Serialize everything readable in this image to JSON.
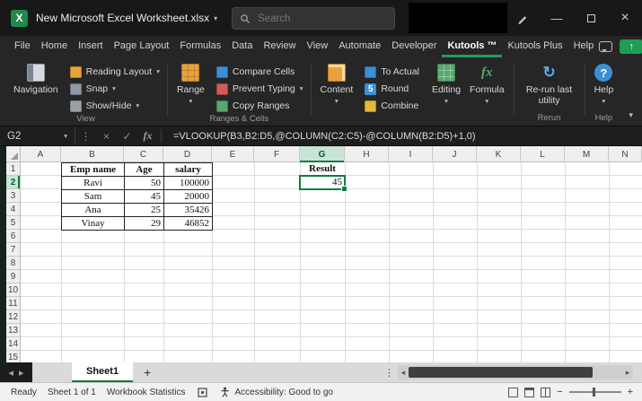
{
  "colors": {
    "accent_green": "#107C41",
    "excel_brand_green": "#1E8A4C"
  },
  "icons": {
    "caret": "▾",
    "dots": "⋮",
    "cancel": "×",
    "confirm": "✓",
    "fx": "fx",
    "minimize": "—",
    "close": "×",
    "plus": "+",
    "app_x": "X",
    "sheet_prev": "◂",
    "sheet_next": "▸",
    "scroll_left": "◂",
    "scroll_right": "▸",
    "overflow": "⋮",
    "zoom_minus": "−",
    "zoom_plus": "+",
    "rerun": "↻",
    "help_q": "?",
    "round_5": "5",
    "up_arrow": "↑"
  },
  "titlebar": {
    "title": "New Microsoft Excel Worksheet.xlsx",
    "search_placeholder": "Search"
  },
  "menu_tabs": [
    "File",
    "Home",
    "Insert",
    "Page Layout",
    "Formulas",
    "Data",
    "Review",
    "View",
    "Automate",
    "Developer",
    "Kutools ™",
    "Kutools Plus",
    "Help"
  ],
  "ribbon": {
    "view": {
      "label": "View",
      "navigation": "Navigation",
      "reading_layout": "Reading Layout",
      "snap": "Snap",
      "show_hide": "Show/Hide"
    },
    "ranges": {
      "label": "Ranges & Cells",
      "range": "Range",
      "compare_cells": "Compare Cells",
      "prevent_typing": "Prevent Typing",
      "copy_ranges": "Copy Ranges"
    },
    "edit": {
      "content": "Content",
      "to_actual": "To Actual",
      "round": "Round",
      "combine": "Combine",
      "editing": "Editing",
      "formula": "Formula"
    },
    "rerun": {
      "label": "Rerun",
      "button": "Re-run last utility"
    },
    "help": {
      "label": "Help",
      "button": "Help"
    }
  },
  "formula_bar": {
    "name_box": "G2",
    "formula": "=VLOOKUP(B3,B2:D5,@COLUMN(C2:C5)-@COLUMN(B2:D5)+1,0)"
  },
  "sheet": {
    "columns": [
      "A",
      "B",
      "C",
      "D",
      "E",
      "F",
      "G",
      "H",
      "I",
      "J",
      "K",
      "L",
      "M",
      "N"
    ],
    "rows": [
      "1",
      "2",
      "3",
      "4",
      "5",
      "6",
      "7",
      "8",
      "9",
      "10",
      "11",
      "12",
      "13",
      "14",
      "15"
    ],
    "table": {
      "rows": [
        [
          "Emp name",
          "Age",
          "salary"
        ],
        [
          "Ravi",
          "50",
          "100000"
        ],
        [
          "Sam",
          "45",
          "20000"
        ],
        [
          "Ana",
          "25",
          "35426"
        ],
        [
          "Vinay",
          "29",
          "46852"
        ]
      ]
    },
    "result_label": "Result",
    "result_value": "45",
    "selected_cell": "G2"
  },
  "sheet_bar": {
    "active_tab": "Sheet1"
  },
  "status_bar": {
    "ready": "Ready",
    "sheet_info": "Sheet 1 of 1",
    "workbook_statistics": "Workbook Statistics",
    "accessibility": "Accessibility: Good to go"
  }
}
